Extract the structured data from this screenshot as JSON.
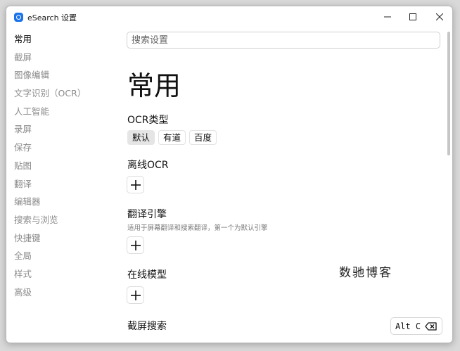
{
  "window": {
    "title": "eSearch 设置",
    "icons": {
      "app": "esearch-logo-icon",
      "minimize": "minimize-icon",
      "maximize": "maximize-icon",
      "close": "close-icon"
    }
  },
  "sidebar": {
    "items": [
      {
        "label": "常用",
        "active": true
      },
      {
        "label": "截屏"
      },
      {
        "label": "图像编辑"
      },
      {
        "label": "文字识别（OCR）"
      },
      {
        "label": "人工智能"
      },
      {
        "label": "录屏"
      },
      {
        "label": "保存"
      },
      {
        "label": "贴图"
      },
      {
        "label": "翻译"
      },
      {
        "label": "编辑器"
      },
      {
        "label": "搜索与浏览"
      },
      {
        "label": "快捷键"
      },
      {
        "label": "全局"
      },
      {
        "label": "样式"
      },
      {
        "label": "高级"
      }
    ]
  },
  "search": {
    "placeholder": "搜索设置",
    "value": ""
  },
  "main": {
    "heading": "常用",
    "ocr_type": {
      "title": "OCR类型",
      "options": [
        "默认",
        "有道",
        "百度"
      ],
      "selected": "默认"
    },
    "offline_ocr": {
      "title": "离线OCR",
      "add_icon": "plus-icon"
    },
    "translate_engine": {
      "title": "翻译引擎",
      "description": "适用于屏幕翻译和搜索翻译，第一个为默认引擎",
      "add_icon": "plus-icon"
    },
    "online_model": {
      "title": "在线模型",
      "add_icon": "plus-icon"
    },
    "screenshot_search": {
      "title": "截屏搜索"
    }
  },
  "watermark": "数驰博客",
  "shortcut": {
    "keys": "Alt C",
    "clear_icon": "backspace-clear-icon"
  }
}
